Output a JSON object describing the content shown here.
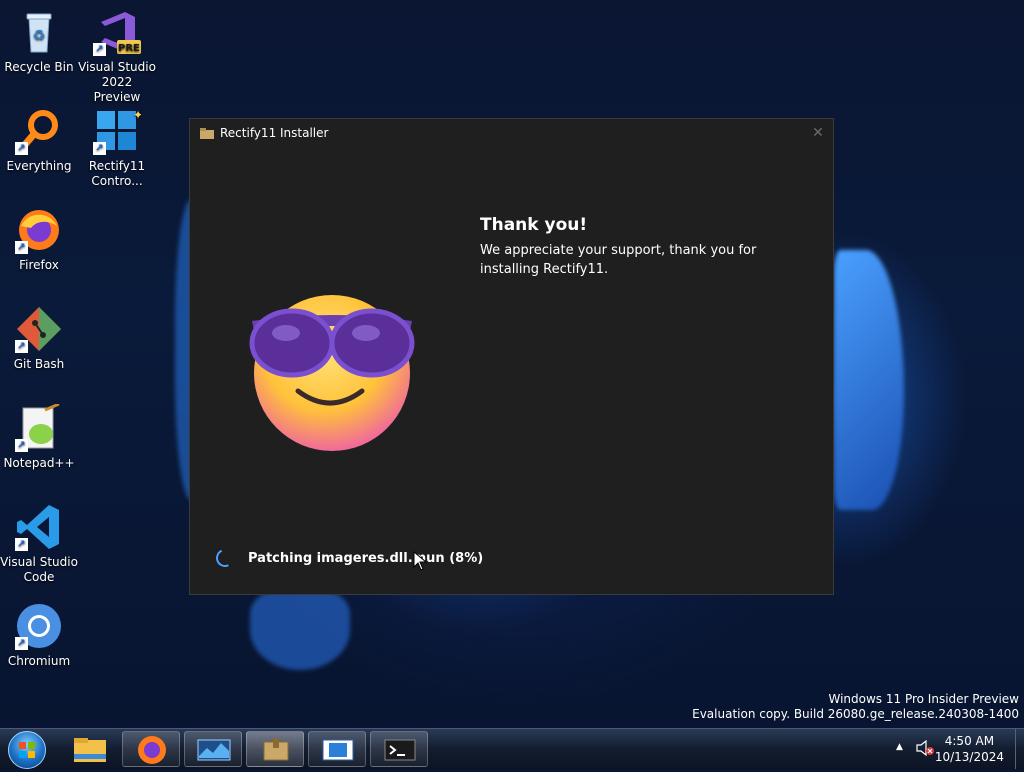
{
  "desktop_icons": [
    {
      "label": "Recycle Bin",
      "icon": "recycle-bin-icon"
    },
    {
      "label": "Visual Studio\n2022 Preview",
      "icon": "visual-studio-preview-icon",
      "badge": "PRE"
    },
    {
      "label": "Everything",
      "icon": "everything-search-icon"
    },
    {
      "label": "Rectify11\nContro...",
      "icon": "rectify11-control-icon"
    },
    {
      "label": "Firefox",
      "icon": "firefox-icon"
    },
    {
      "label": "Git Bash",
      "icon": "git-bash-icon"
    },
    {
      "label": "Notepad++",
      "icon": "notepad-plus-plus-icon"
    },
    {
      "label": "Visual Studio\nCode",
      "icon": "vscode-icon"
    },
    {
      "label": "Chromium",
      "icon": "chromium-icon"
    }
  ],
  "installer": {
    "title": "Rectify11 Installer",
    "heading": "Thank you!",
    "message": "We appreciate your support, thank you for installing Rectify11.",
    "status_text": "Patching imageres.dll.mun (8%)",
    "progress_percent": 8,
    "close_glyph": "✕"
  },
  "watermark": {
    "line1": "Windows 11 Pro Insider Preview",
    "line2": "Evaluation copy. Build 26080.ge_release.240308-1400"
  },
  "taskbar": {
    "apps": [
      "file-explorer-icon",
      "firefox-icon",
      "task-manager-icon",
      "installer-icon",
      "media-icon",
      "terminal-icon"
    ],
    "active_app": "installer-icon"
  },
  "tray": {
    "chevron": "▲",
    "time": "4:50 AM",
    "date": "10/13/2024"
  },
  "colors": {
    "window_bg": "#1f1f1f",
    "accent": "#4aa3ff",
    "taskbar_bg": "#131d30"
  }
}
